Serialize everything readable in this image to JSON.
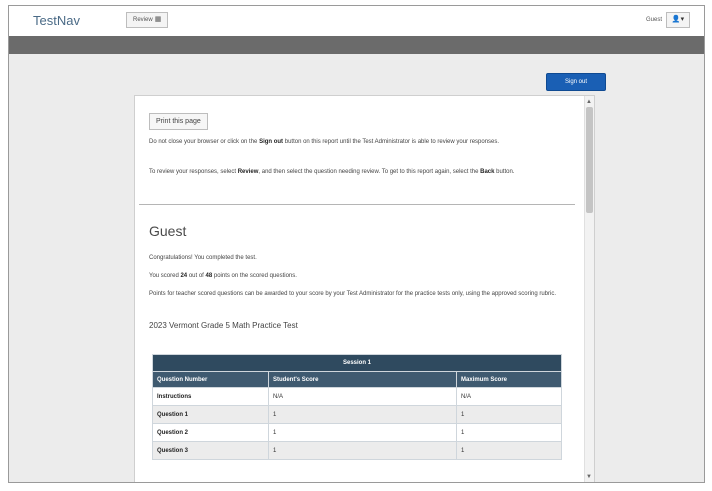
{
  "app": {
    "brand": "TestNav",
    "review_label": "Review",
    "review_icon": "grid-icon",
    "user_name": "Guest",
    "user_icon": "user-icon"
  },
  "actions": {
    "sign_out": "Sign out",
    "print": "Print this page"
  },
  "notice": {
    "line1_pre": "Do not close your browser or click on the ",
    "line1_bold": "Sign out",
    "line1_post": " button on this report until the Test Administrator is able to review your responses.",
    "line2_pre": "To review your responses, select ",
    "line2_bold1": "Review",
    "line2_mid": ", and then select the question needing review. To get to this report again, select the ",
    "line2_bold2": "Back",
    "line2_post": " button."
  },
  "result": {
    "title": "Guest",
    "congrats": "Congratulations! You completed the test.",
    "score_pre": "You scored ",
    "score": "24",
    "score_mid": " out of ",
    "max": "48",
    "score_post": " points on the scored questions.",
    "points_note": "Points for teacher scored questions can be awarded to your score by your Test Administrator for the practice tests only, using the approved scoring rubric.",
    "test_name": "2023 Vermont Grade 5 Math Practice Test"
  },
  "table": {
    "session": "Session 1",
    "headers": [
      "Question Number",
      "Student's Score",
      "Maximum Score"
    ],
    "rows": [
      [
        "Instructions",
        "N/A",
        "N/A"
      ],
      [
        "Question 1",
        "1",
        "1"
      ],
      [
        "Question 2",
        "1",
        "1"
      ],
      [
        "Question 3",
        "1",
        "1"
      ]
    ]
  },
  "colors": {
    "accent": "#1a5fb4",
    "header_stripe": "#6b6b6b",
    "table_header": "#2f4a5f"
  }
}
